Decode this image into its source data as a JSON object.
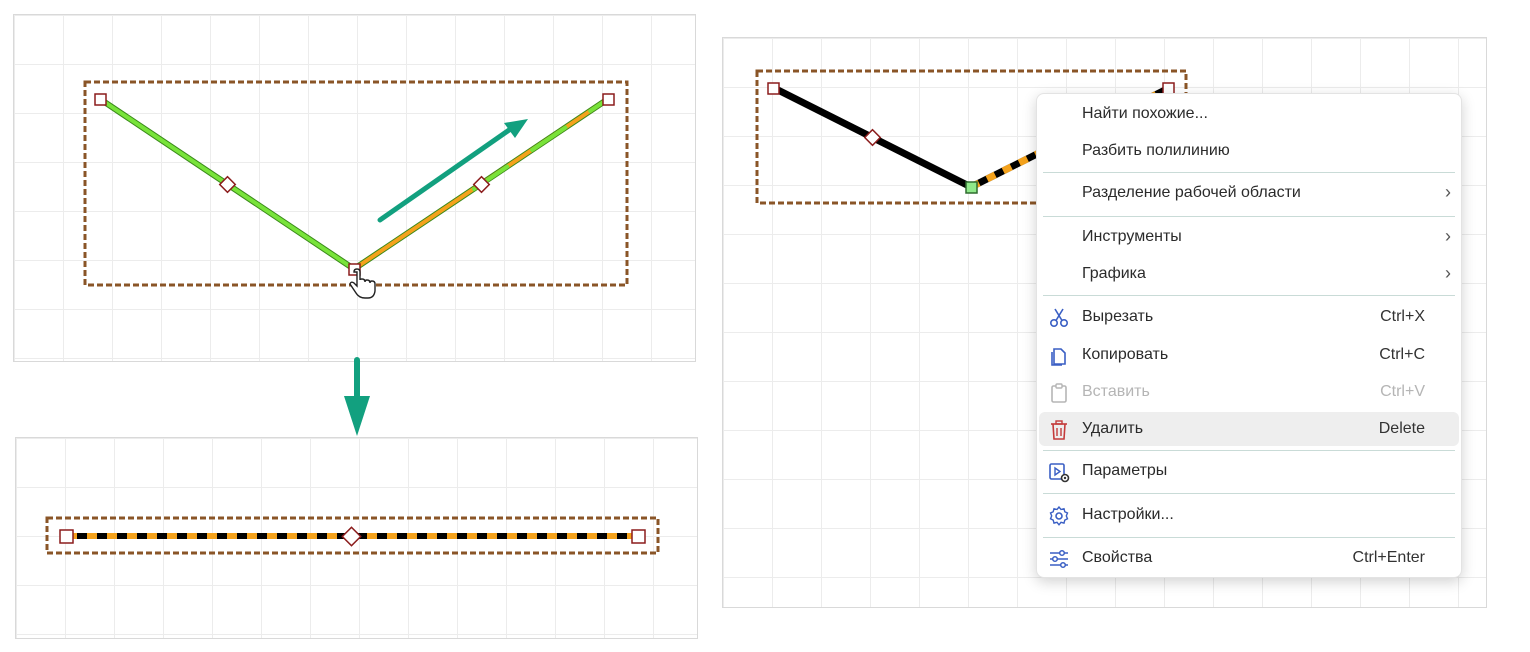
{
  "colors": {
    "accent_teal": "#12a07f",
    "line_green": "#78e33a",
    "line_orange": "#f4a21c",
    "selection_brown": "#8a5527",
    "handle_red": "#8b1c1c",
    "menu_hover": "#eeeeee"
  },
  "context_menu": {
    "items": [
      {
        "label": "Найти похожие...",
        "shortcut": "",
        "submenu": false,
        "icon": "none"
      },
      {
        "label": "Разбить полилинию",
        "shortcut": "",
        "submenu": false,
        "icon": "none"
      },
      {
        "label": "Разделение рабочей области",
        "shortcut": "",
        "submenu": true,
        "icon": "none"
      },
      {
        "label": "Инструменты",
        "shortcut": "",
        "submenu": true,
        "icon": "none"
      },
      {
        "label": "Графика",
        "shortcut": "",
        "submenu": true,
        "icon": "none"
      },
      {
        "label": "Вырезать",
        "shortcut": "Ctrl+X",
        "submenu": false,
        "icon": "scissors-icon"
      },
      {
        "label": "Копировать",
        "shortcut": "Ctrl+C",
        "submenu": false,
        "icon": "copy-icon"
      },
      {
        "label": "Вставить",
        "shortcut": "Ctrl+V",
        "submenu": false,
        "icon": "clipboard-icon",
        "disabled": true
      },
      {
        "label": "Удалить",
        "shortcut": "Delete",
        "submenu": false,
        "icon": "trash-icon",
        "highlighted": true
      },
      {
        "label": "Параметры",
        "shortcut": "",
        "submenu": false,
        "icon": "parameters-icon"
      },
      {
        "label": "Настройки...",
        "shortcut": "",
        "submenu": false,
        "icon": "gear-icon"
      },
      {
        "label": "Свойства",
        "shortcut": "Ctrl+Enter",
        "submenu": false,
        "icon": "sliders-icon"
      }
    ],
    "chevron": "›"
  }
}
